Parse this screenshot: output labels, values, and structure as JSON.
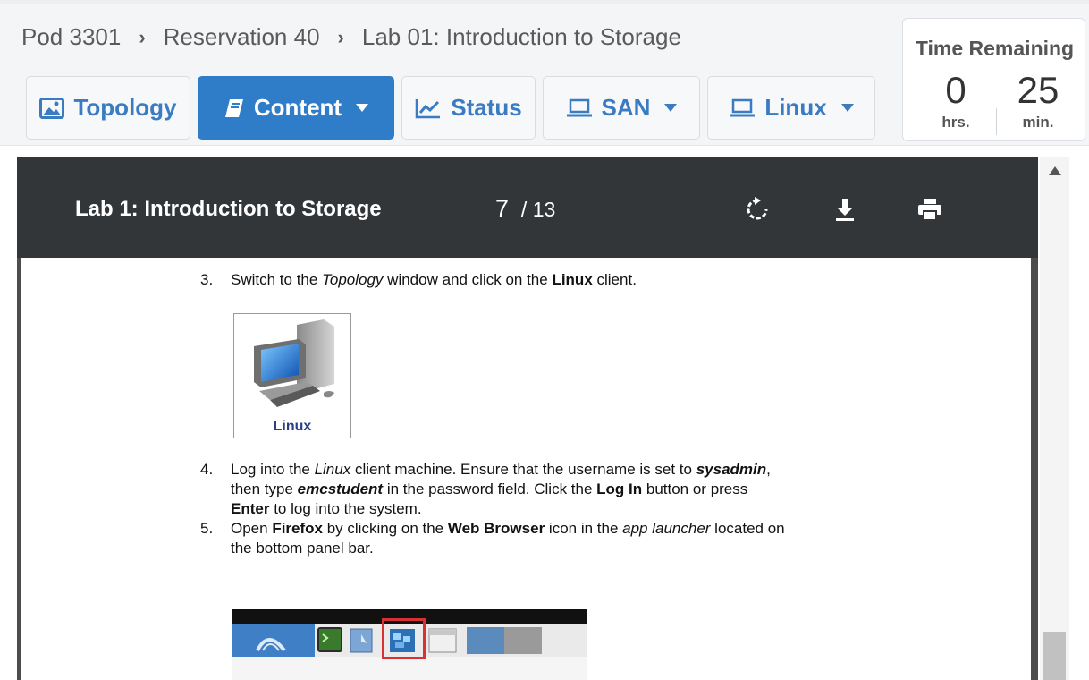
{
  "breadcrumb": {
    "pod": "Pod 3301",
    "reservation": "Reservation 40",
    "lab": "Lab 01: Introduction to Storage"
  },
  "nav": {
    "topology": "Topology",
    "content": "Content",
    "status": "Status",
    "san": "SAN",
    "linux": "Linux"
  },
  "timer": {
    "title": "Time Remaining",
    "hours": "0",
    "hours_unit": "hrs.",
    "minutes": "25",
    "minutes_unit": "min."
  },
  "viewer": {
    "title": "Lab 1: Introduction to Storage",
    "current_page": "7",
    "total_pages": "13"
  },
  "document": {
    "step3": {
      "num": "3.",
      "t1": "Switch to the ",
      "t2": "Topology",
      "t3": " window and click on the ",
      "t4": "Linux",
      "t5": " client."
    },
    "linux_label": "Linux",
    "step4": {
      "num": "4.",
      "l1a": "Log into the ",
      "l1b": "Linux",
      "l1c": " client machine.  Ensure that the username is set to ",
      "l1d": "sysadmin",
      "l1e": ",",
      "l2a": "then type ",
      "l2b": "emcstudent",
      "l2c": " in the password field.  Click the ",
      "l2d": "Log In",
      "l2e": " button or press",
      "l3a": "Enter",
      "l3b": " to log into the system."
    },
    "step5": {
      "num": "5.",
      "l1a": "Open ",
      "l1b": "Firefox",
      "l1c": " by clicking on the ",
      "l1d": "Web Browser",
      "l1e": " icon in the ",
      "l1f": "app launcher",
      "l1g": " located on",
      "l2": "the bottom panel bar."
    }
  },
  "colors": {
    "accent": "#2f7dc9",
    "link_text": "#3a7bc1",
    "toolbar": "#323639",
    "highlight": "#d9312f"
  }
}
